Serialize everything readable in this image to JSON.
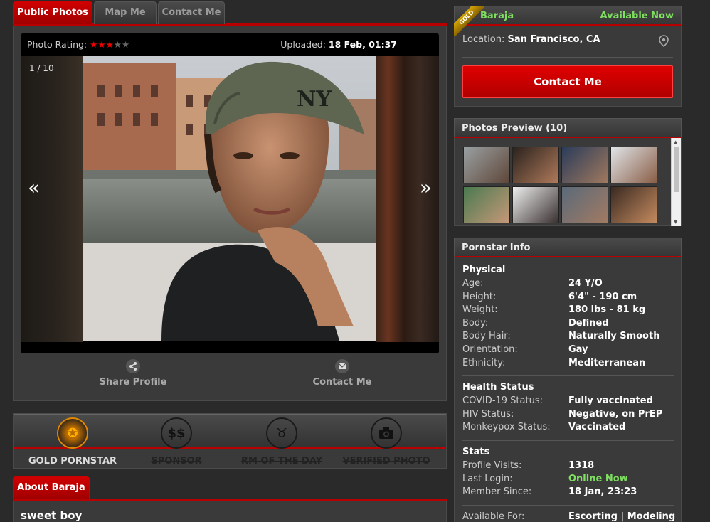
{
  "tabs": [
    {
      "label": "Public Photos",
      "active": true
    },
    {
      "label": "Map Me",
      "active": false
    },
    {
      "label": "Contact Me",
      "active": false
    }
  ],
  "viewer": {
    "rating_label": "Photo Rating:",
    "rating": 3,
    "rating_max": 5,
    "uploaded_label": "Uploaded:",
    "uploaded_value": "18 Feb, 01:37",
    "counter": "1 / 10",
    "prev_arrow": "«",
    "next_arrow": "»"
  },
  "actions": {
    "share": "Share Profile",
    "contact": "Contact Me"
  },
  "badges": [
    {
      "label": "GOLD PORNSTAR",
      "active": true,
      "icon": "medal-icon"
    },
    {
      "label": "SPONSOR",
      "active": false,
      "icon": "dollar-icon"
    },
    {
      "label": "RM OF THE DAY",
      "active": false,
      "icon": "devil-icon"
    },
    {
      "label": "VERIFIED PHOTO",
      "active": false,
      "icon": "camera-icon"
    }
  ],
  "about": {
    "tab_label": "About Baraja",
    "text": "sweet boy"
  },
  "profile": {
    "ribbon": "GOLD",
    "name": "Baraja",
    "availability": "Available Now",
    "location_label": "Location:",
    "location": "San Francisco, CA",
    "contact_button": "Contact Me"
  },
  "preview": {
    "title": "Photos Preview (10)",
    "thumb_count": 8
  },
  "info": {
    "title": "Pornstar Info",
    "physical": {
      "heading": "Physical",
      "rows": [
        {
          "k": "Age:",
          "v": "24 Y/O"
        },
        {
          "k": "Height:",
          "v": "6'4\" - 190 cm"
        },
        {
          "k": "Weight:",
          "v": "180 lbs - 81 kg"
        },
        {
          "k": "Body:",
          "v": "Defined"
        },
        {
          "k": "Body Hair:",
          "v": "Naturally Smooth"
        },
        {
          "k": "Orientation:",
          "v": "Gay"
        },
        {
          "k": "Ethnicity:",
          "v": "Mediterranean"
        }
      ]
    },
    "health": {
      "heading": "Health Status",
      "rows": [
        {
          "k": "COVID-19 Status:",
          "v": "Fully vaccinated"
        },
        {
          "k": "HIV Status:",
          "v": "Negative, on PrEP"
        },
        {
          "k": "Monkeypox Status:",
          "v": "Vaccinated"
        }
      ]
    },
    "stats": {
      "heading": "Stats",
      "rows": [
        {
          "k": "Profile Visits:",
          "v": "1318"
        },
        {
          "k": "Last Login:",
          "v": "Online Now"
        },
        {
          "k": "Member Since:",
          "v": "18 Jan, 23:23"
        }
      ]
    },
    "available_for": {
      "k": "Available For:",
      "v": "Escorting | Modeling"
    }
  },
  "colors": {
    "accent_red": "#c00000",
    "online_green": "#7fe060",
    "gold": "#e08800"
  }
}
